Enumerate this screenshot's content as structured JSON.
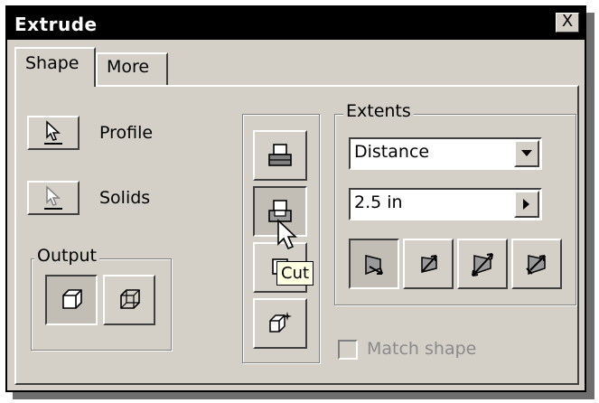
{
  "window": {
    "title": "Extrude",
    "close_label": "X"
  },
  "tabs": [
    {
      "label": "Shape"
    },
    {
      "label": "More"
    }
  ],
  "left": {
    "profile_label": "Profile",
    "solids_label": "Solids",
    "output_group_label": "Output"
  },
  "extents": {
    "group_label": "Extents",
    "type_value": "Distance",
    "distance_value": "2.5 in"
  },
  "tooltip": {
    "text": "Cut"
  },
  "match_shape_label": "Match shape"
}
